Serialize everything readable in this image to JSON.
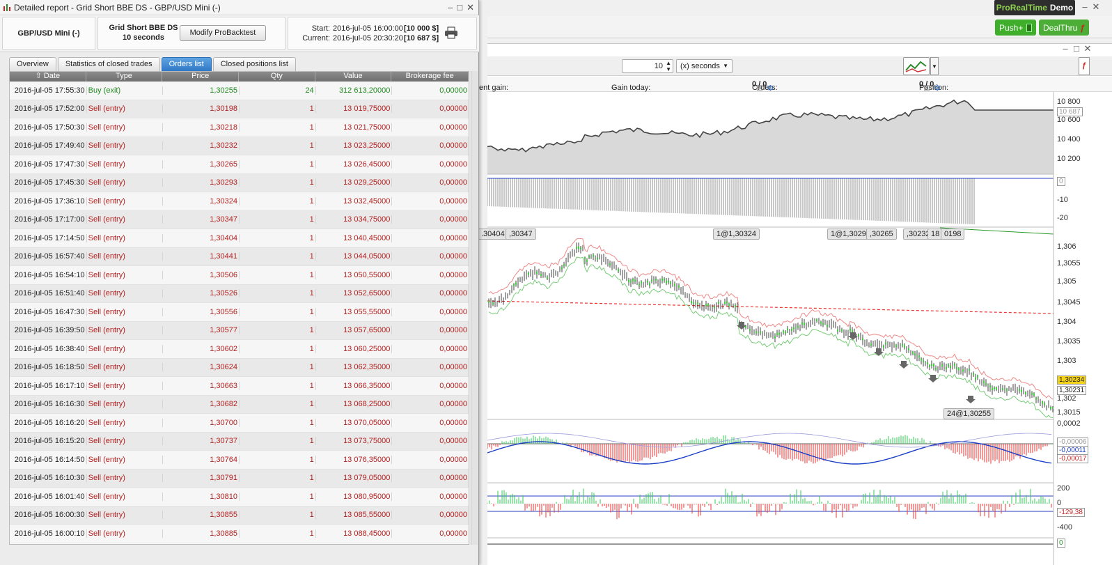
{
  "platform": {
    "brand_a": "ProRealTime",
    "brand_b": "Demo",
    "push_label": "Push+",
    "dealthru_label": "DealThru",
    "period_value": "10",
    "period_unit": "(x) seconds",
    "info": {
      "current_gain_label": "ent gain:",
      "current_gain_value": "-",
      "gain_today_label": "Gain today:",
      "gain_today_value": "-",
      "orders_label": "Orders:",
      "orders_a": "0",
      "orders_b": "/ 0",
      "position_label": "Position:",
      "position_a": "0",
      "position_b": "/ 0"
    },
    "equity_axis": [
      "10 800",
      "10 687",
      "10 600",
      "10 400",
      "10 200"
    ],
    "position_axis": [
      "0",
      "-10",
      "-20"
    ],
    "price_axis": [
      "1,306",
      "1,3055",
      "1,305",
      "1,3045",
      "1,304",
      "1,3035",
      "1,303",
      "1,30234",
      "1,30231",
      "1,302",
      "1,3015"
    ],
    "macd_axis": [
      "0,0002",
      "-0,00006",
      "-0,00011",
      "-0,00017"
    ],
    "cci_axis": [
      "200",
      "0",
      "-129,38",
      "-400"
    ],
    "bottom_axis": "0",
    "order_chips": [
      ".30404",
      ",30347",
      "1@1,30324",
      "1@1,30293",
      ",30265",
      ",30232",
      "18",
      "0198",
      "24@1,30255"
    ],
    "colors": {
      "buy": "#1f8a1f",
      "sell": "#b21e1e",
      "tab_active": "#3a86d1",
      "push_green": "#3fae2a"
    }
  },
  "report": {
    "window_title": "Detailed report - Grid Short BBE DS - GBP/USD Mini (-)",
    "instrument": "GBP/USD Mini (-)",
    "system_name": "Grid Short BBE DS",
    "timeframe": "10 seconds",
    "modify_button": "Modify ProBacktest",
    "start_label": "Start:",
    "start_value": "2016-jul-05 16:00:00",
    "start_capital": "[10 000 $]",
    "current_label": "Current:",
    "current_value": "2016-jul-05 20:30:20",
    "current_capital": "[10 687 $]",
    "tabs": [
      "Overview",
      "Statistics of closed trades",
      "Orders list",
      "Closed positions list"
    ],
    "columns": [
      "Date",
      "Type",
      "Price",
      "Qty",
      "Value",
      "Brokerage fee"
    ],
    "rows": [
      [
        "2016-jul-05 17:55:30",
        "Buy (exit)",
        "1,30255",
        "24",
        "312 613,20000",
        "0,00000"
      ],
      [
        "2016-jul-05 17:52:00",
        "Sell (entry)",
        "1,30198",
        "1",
        "13 019,75000",
        "0,00000"
      ],
      [
        "2016-jul-05 17:50:30",
        "Sell (entry)",
        "1,30218",
        "1",
        "13 021,75000",
        "0,00000"
      ],
      [
        "2016-jul-05 17:49:40",
        "Sell (entry)",
        "1,30232",
        "1",
        "13 023,25000",
        "0,00000"
      ],
      [
        "2016-jul-05 17:47:30",
        "Sell (entry)",
        "1,30265",
        "1",
        "13 026,45000",
        "0,00000"
      ],
      [
        "2016-jul-05 17:45:30",
        "Sell (entry)",
        "1,30293",
        "1",
        "13 029,25000",
        "0,00000"
      ],
      [
        "2016-jul-05 17:36:10",
        "Sell (entry)",
        "1,30324",
        "1",
        "13 032,45000",
        "0,00000"
      ],
      [
        "2016-jul-05 17:17:00",
        "Sell (entry)",
        "1,30347",
        "1",
        "13 034,75000",
        "0,00000"
      ],
      [
        "2016-jul-05 17:14:50",
        "Sell (entry)",
        "1,30404",
        "1",
        "13 040,45000",
        "0,00000"
      ],
      [
        "2016-jul-05 16:57:40",
        "Sell (entry)",
        "1,30441",
        "1",
        "13 044,05000",
        "0,00000"
      ],
      [
        "2016-jul-05 16:54:10",
        "Sell (entry)",
        "1,30506",
        "1",
        "13 050,55000",
        "0,00000"
      ],
      [
        "2016-jul-05 16:51:40",
        "Sell (entry)",
        "1,30526",
        "1",
        "13 052,65000",
        "0,00000"
      ],
      [
        "2016-jul-05 16:47:30",
        "Sell (entry)",
        "1,30556",
        "1",
        "13 055,55000",
        "0,00000"
      ],
      [
        "2016-jul-05 16:39:50",
        "Sell (entry)",
        "1,30577",
        "1",
        "13 057,65000",
        "0,00000"
      ],
      [
        "2016-jul-05 16:38:40",
        "Sell (entry)",
        "1,30602",
        "1",
        "13 060,25000",
        "0,00000"
      ],
      [
        "2016-jul-05 16:18:50",
        "Sell (entry)",
        "1,30624",
        "1",
        "13 062,35000",
        "0,00000"
      ],
      [
        "2016-jul-05 16:17:10",
        "Sell (entry)",
        "1,30663",
        "1",
        "13 066,35000",
        "0,00000"
      ],
      [
        "2016-jul-05 16:16:30",
        "Sell (entry)",
        "1,30682",
        "1",
        "13 068,25000",
        "0,00000"
      ],
      [
        "2016-jul-05 16:16:20",
        "Sell (entry)",
        "1,30700",
        "1",
        "13 070,05000",
        "0,00000"
      ],
      [
        "2016-jul-05 16:15:20",
        "Sell (entry)",
        "1,30737",
        "1",
        "13 073,75000",
        "0,00000"
      ],
      [
        "2016-jul-05 16:14:50",
        "Sell (entry)",
        "1,30764",
        "1",
        "13 076,35000",
        "0,00000"
      ],
      [
        "2016-jul-05 16:10:30",
        "Sell (entry)",
        "1,30791",
        "1",
        "13 079,05000",
        "0,00000"
      ],
      [
        "2016-jul-05 16:01:40",
        "Sell (entry)",
        "1,30810",
        "1",
        "13 080,95000",
        "0,00000"
      ],
      [
        "2016-jul-05 16:00:30",
        "Sell (entry)",
        "1,30855",
        "1",
        "13 085,55000",
        "0,00000"
      ],
      [
        "2016-jul-05 16:00:10",
        "Sell (entry)",
        "1,30885",
        "1",
        "13 088,45000",
        "0,00000"
      ]
    ]
  }
}
